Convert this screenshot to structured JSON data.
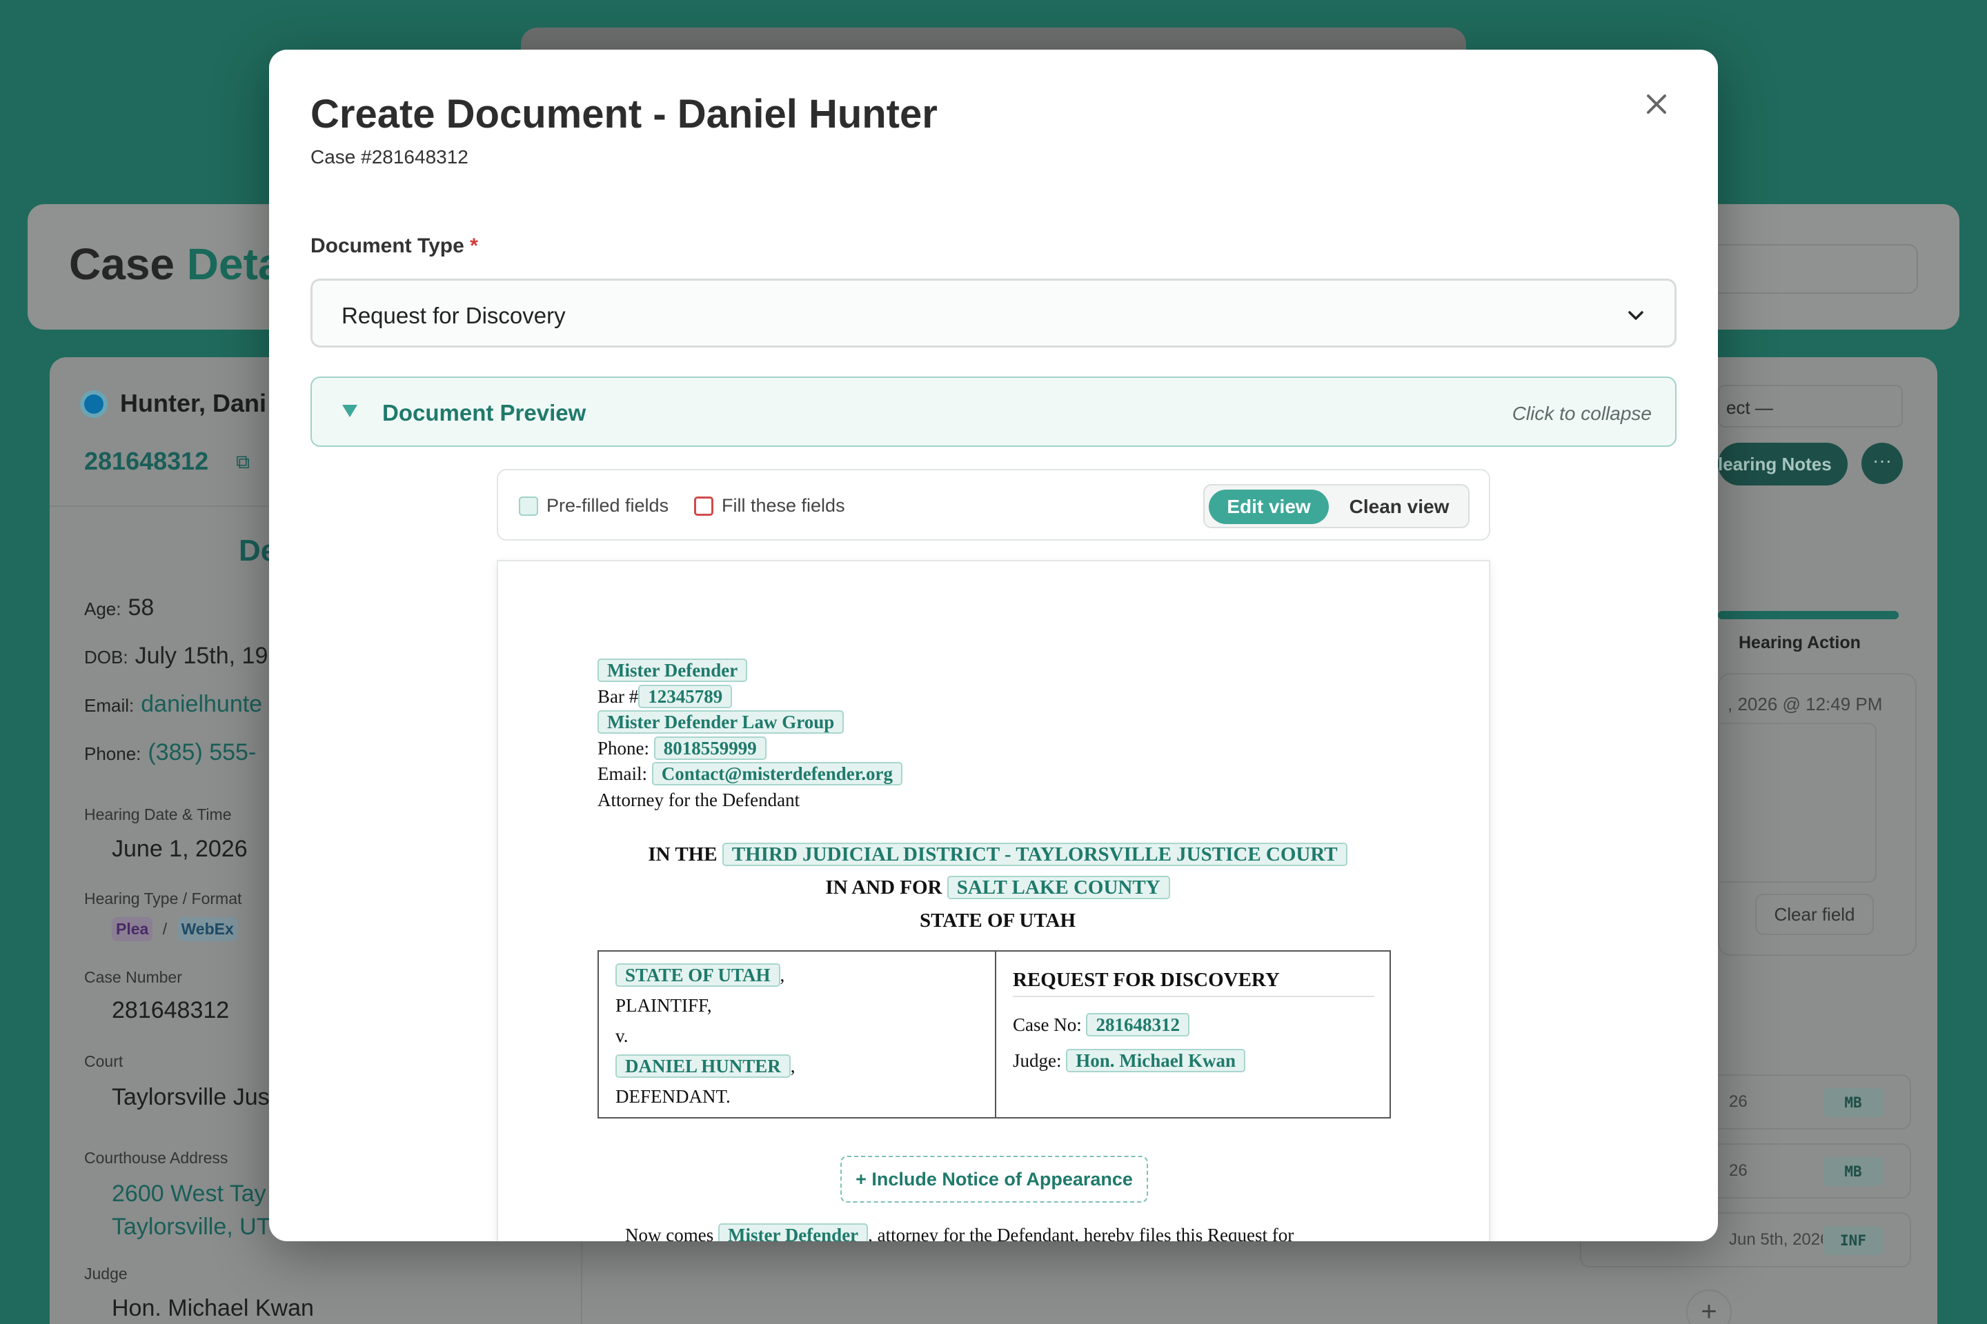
{
  "background": {
    "header_title_a": "Case",
    "header_title_b": "Deta",
    "client_name": "Hunter, Dani",
    "case_number": "281648312",
    "section_heading": "De",
    "age_label": "Age:",
    "age_value": "58",
    "dob_label": "DOB:",
    "dob_value": "July 15th, 19",
    "email_label": "Email:",
    "email_value": "danielhunte",
    "phone_label": "Phone:",
    "phone_value": "(385) 555-",
    "hearing_dt_label": "Hearing Date & Time",
    "hearing_dt_value": "June 1, 2026",
    "hearing_type_label": "Hearing Type / Format",
    "hearing_type": "Plea",
    "hearing_sep": "/",
    "hearing_format": "WebEx",
    "case_number_label": "Case Number",
    "case_number_value": "281648312",
    "court_label": "Court",
    "court_value": "Taylorsville Jus",
    "address_label": "Courthouse Address",
    "address_line1": "2600 West Tay",
    "address_line2": "Taylorsville, UT",
    "judge_label": "Judge",
    "judge_value": "Hon. Michael Kwan",
    "right_select": "ect —",
    "hearing_notes_btn": "learing Notes",
    "more_btn": "···",
    "hearing_action": "Hearing Action",
    "note_date": ", 2026 @ 12:49 PM",
    "clear_field": "Clear field",
    "rows": [
      {
        "date": "26",
        "tag": "MB"
      },
      {
        "date": "26",
        "tag": "MB"
      },
      {
        "date": "Jun 5th, 2026",
        "tag": "INF"
      }
    ],
    "add_btn": "+"
  },
  "modal": {
    "title": "Create Document - Daniel Hunter",
    "subtitle": "Case #281648312",
    "doc_type_label": "Document Type",
    "required_mark": "*",
    "doc_type_value": "Request for Discovery",
    "preview_title": "Document Preview",
    "preview_hint": "Click to collapse",
    "legend_prefilled": "Pre-filled fields",
    "legend_fill": "Fill these fields",
    "edit_view": "Edit view",
    "clean_view": "Clean view",
    "include_notice": "+ Include Notice of Appearance"
  },
  "document": {
    "attorney_name": "Mister Defender",
    "bar_label": "Bar #",
    "bar_number": "12345789",
    "firm": "Mister Defender Law Group",
    "phone_label": "Phone:",
    "phone": "8018559999",
    "email_label": "Email:",
    "email": "Contact@misterdefender.org",
    "attorney_for": "Attorney for the Defendant",
    "in_the": "IN THE",
    "court_name": "THIRD JUDICIAL DISTRICT - TAYLORSVILLE JUSTICE COURT",
    "in_and_for": "IN AND FOR",
    "county": "SALT LAKE COUNTY",
    "state_line": "STATE OF UTAH",
    "plaintiff_name": "STATE OF UTAH",
    "comma": ",",
    "plaintiff_label": "PLAINTIFF,",
    "versus": "v.",
    "defendant_name": "DANIEL HUNTER",
    "defendant_label": "DEFENDANT.",
    "doc_title": "REQUEST FOR DISCOVERY",
    "case_no_label": "Case No:",
    "case_no": "281648312",
    "judge_label": "Judge:",
    "judge": "Hon. Michael Kwan",
    "body_start": "Now comes",
    "body_attorney": "Mister Defender",
    "body_rest": ", attorney for the Defendant, hereby files this Request for"
  },
  "colors": {
    "accent": "#3da898",
    "accent_text": "#1f7a6b",
    "prefilled_bg": "#e4f3f0",
    "fill_border": "#d14b4b",
    "backdrop": "#1f6a5c"
  },
  "icons": [
    "close-icon",
    "chevron-down-icon",
    "collapse-triangle-icon",
    "copy-icon",
    "status-dot-icon",
    "plus-icon"
  ]
}
